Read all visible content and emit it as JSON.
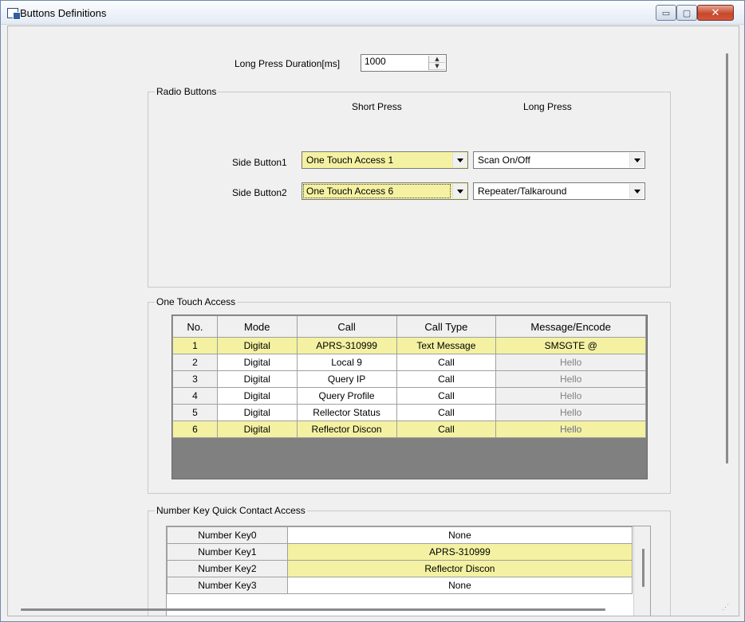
{
  "window": {
    "title": "Buttons Definitions",
    "controls": {
      "minimize": "▭",
      "maximize": "▢",
      "close": "✕"
    }
  },
  "long_press": {
    "label": "Long Press Duration[ms]",
    "value": "1000"
  },
  "radio_buttons": {
    "title": "Radio Buttons",
    "col_short": "Short Press",
    "col_long": "Long Press",
    "rows": [
      {
        "label": "Side Button1",
        "short": "One Touch Access 1",
        "long": "Scan On/Off"
      },
      {
        "label": "Side Button2",
        "short": "One Touch Access 6",
        "long": "Repeater/Talkaround"
      }
    ]
  },
  "one_touch": {
    "title": "One Touch Access",
    "headers": [
      "No.",
      "Mode",
      "Call",
      "Call Type",
      "Message/Encode"
    ],
    "rows": [
      {
        "no": "1",
        "mode": "Digital",
        "call": "APRS-310999",
        "type": "Text Message",
        "msg": "SMSGTE @"
      },
      {
        "no": "2",
        "mode": "Digital",
        "call": "Local 9",
        "type": "Call",
        "msg": "Hello"
      },
      {
        "no": "3",
        "mode": "Digital",
        "call": "Query IP",
        "type": "Call",
        "msg": "Hello"
      },
      {
        "no": "4",
        "mode": "Digital",
        "call": "Query Profile",
        "type": "Call",
        "msg": "Hello"
      },
      {
        "no": "5",
        "mode": "Digital",
        "call": "Rellector Status",
        "type": "Call",
        "msg": "Hello"
      },
      {
        "no": "6",
        "mode": "Digital",
        "call": "Reflector Discon",
        "type": "Call",
        "msg": "Hello"
      }
    ]
  },
  "number_keys": {
    "title": "Number Key Quick Contact Access",
    "rows": [
      {
        "key": "Number Key0",
        "value": "None"
      },
      {
        "key": "Number Key1",
        "value": "APRS-310999"
      },
      {
        "key": "Number Key2",
        "value": "Reflector Discon"
      },
      {
        "key": "Number Key3",
        "value": "None"
      }
    ]
  },
  "colors": {
    "highlight": "#f4f2a2",
    "title_bar": "#e3ebf5",
    "close_button": "#c7482c"
  }
}
